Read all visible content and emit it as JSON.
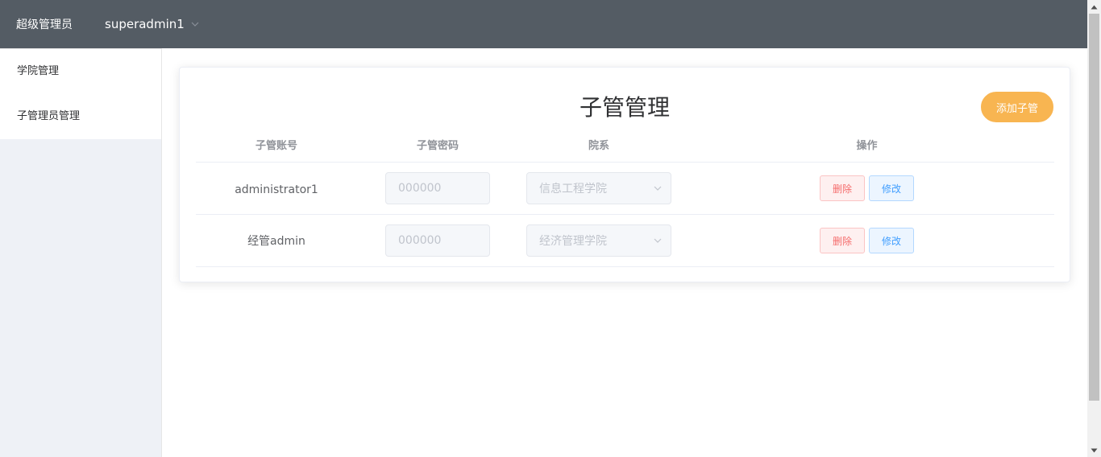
{
  "header": {
    "brand": "超级管理员",
    "username": "superadmin1",
    "icons": {
      "user_menu": "chevron-down-icon"
    }
  },
  "sidebar": {
    "items": [
      {
        "label": "学院管理"
      },
      {
        "label": "子管理员管理"
      }
    ]
  },
  "main": {
    "title": "子管管理",
    "add_button": "添加子管",
    "table": {
      "headers": [
        "子管账号",
        "子管密码",
        "院系",
        "操作"
      ],
      "rows": [
        {
          "account": "administrator1",
          "password_placeholder": "000000",
          "department": "信息工程学院",
          "delete": "删除",
          "edit": "修改"
        },
        {
          "account": "经管admin",
          "password_placeholder": "000000",
          "department": "经济管理学院",
          "delete": "删除",
          "edit": "修改"
        }
      ]
    }
  },
  "colors": {
    "header_bg": "#545c64",
    "accent_orange": "#f8b551",
    "danger": "#f56c6c",
    "primary": "#409eff",
    "sidebar_bg": "#eef1f6"
  }
}
